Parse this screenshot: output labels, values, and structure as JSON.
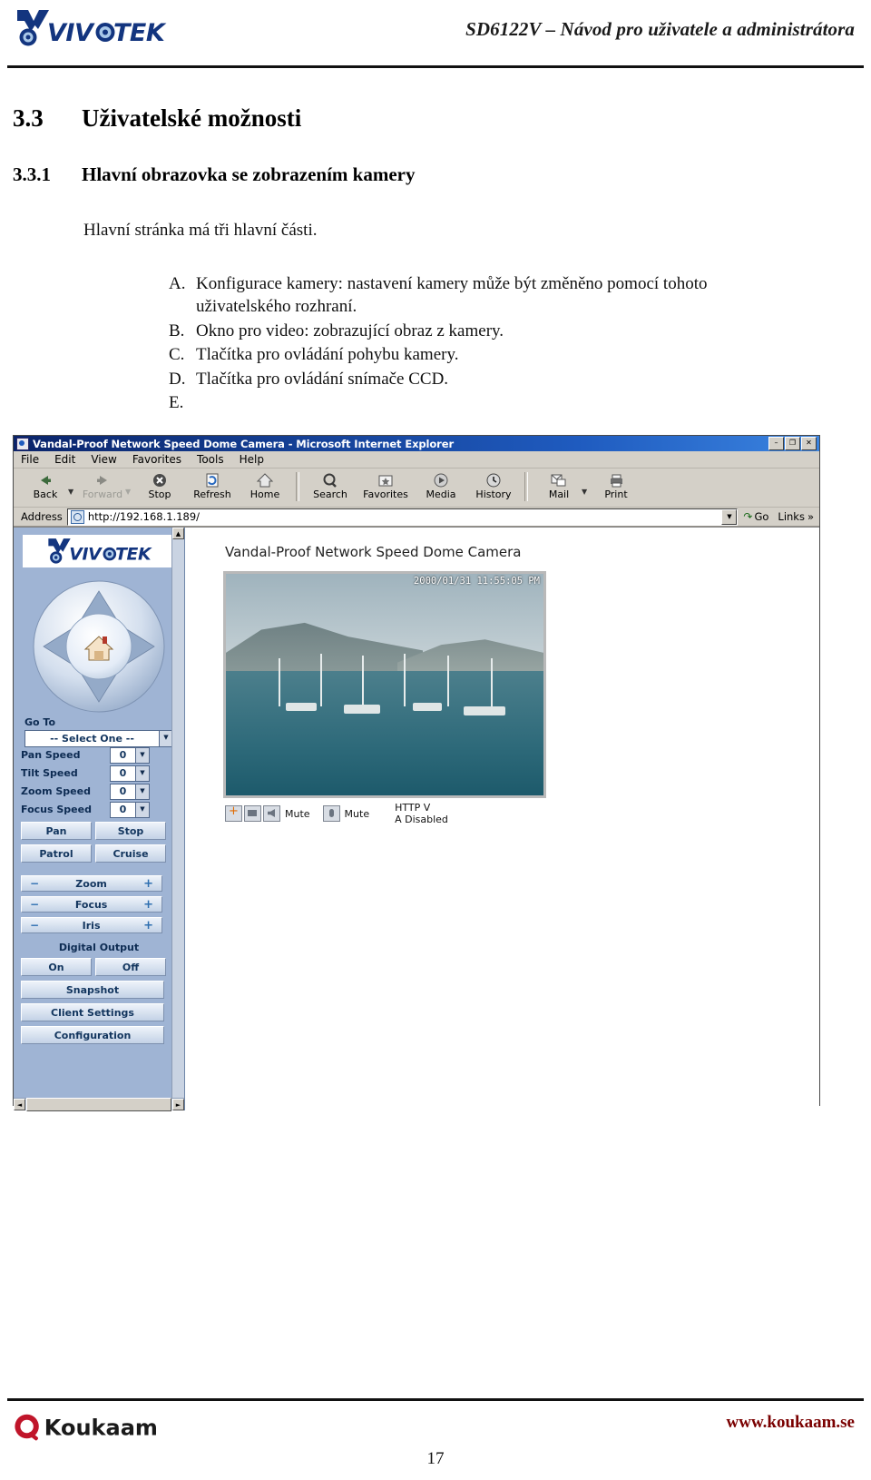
{
  "header": {
    "logo": "vivotek-logo",
    "title": "SD6122V – Návod pro uživatele a administrátora"
  },
  "document": {
    "section_number": "3.3",
    "section_title": "Uživatelské možnosti",
    "subsection_number": "3.3.1",
    "subsection_title": "Hlavní obrazovka se zobrazením kamery",
    "intro": "Hlavní stránka má tři hlavní části.",
    "items": [
      {
        "key": "A.",
        "text": "Konfigurace kamery: nastavení kamery může být změněno pomocí tohoto uživatelského rozhraní."
      },
      {
        "key": "B.",
        "text": "Okno pro video:  zobrazující obraz z kamery."
      },
      {
        "key": "C.",
        "text": "Tlačítka pro ovládání pohybu kamery."
      },
      {
        "key": "D.",
        "text": "Tlačítka pro ovládání snímače CCD."
      },
      {
        "key": "E.",
        "text": ""
      }
    ]
  },
  "browser": {
    "title": "Vandal-Proof Network Speed Dome Camera - Microsoft Internet Explorer",
    "window_buttons": [
      "–",
      "❐",
      "✕"
    ],
    "menus": [
      "File",
      "Edit",
      "View",
      "Favorites",
      "Tools",
      "Help"
    ],
    "toolbar": [
      {
        "label": "Back",
        "icon": "back-arrow-icon",
        "disabled": false,
        "dropdown": true
      },
      {
        "label": "Forward",
        "icon": "forward-arrow-icon",
        "disabled": true,
        "dropdown": true
      },
      {
        "label": "Stop",
        "icon": "stop-icon",
        "disabled": false,
        "dropdown": false
      },
      {
        "label": "Refresh",
        "icon": "refresh-icon",
        "disabled": false,
        "dropdown": false
      },
      {
        "label": "Home",
        "icon": "home-icon",
        "disabled": false,
        "dropdown": false
      },
      {
        "label": "Search",
        "icon": "search-icon",
        "disabled": false,
        "dropdown": false
      },
      {
        "label": "Favorites",
        "icon": "favorites-star-icon",
        "disabled": false,
        "dropdown": false
      },
      {
        "label": "Media",
        "icon": "media-icon",
        "disabled": false,
        "dropdown": false
      },
      {
        "label": "History",
        "icon": "history-icon",
        "disabled": false,
        "dropdown": false
      },
      {
        "label": "Mail",
        "icon": "mail-icon",
        "disabled": false,
        "dropdown": true
      },
      {
        "label": "Print",
        "icon": "print-icon",
        "disabled": false,
        "dropdown": false
      }
    ],
    "address_label": "Address",
    "address_value": "http://192.168.1.189/",
    "go_label": "Go",
    "links_label": "Links"
  },
  "camera": {
    "logo": "vivotek-logo",
    "joystick": {
      "home": "home-icon",
      "directions": [
        "up",
        "right",
        "down",
        "left"
      ]
    },
    "goto_label": "Go To",
    "goto_value": "-- Select One --",
    "speeds": [
      {
        "label": "Pan Speed",
        "value": "0"
      },
      {
        "label": "Tilt Speed",
        "value": "0"
      },
      {
        "label": "Zoom Speed",
        "value": "0"
      },
      {
        "label": "Focus Speed",
        "value": "0"
      }
    ],
    "move_buttons": [
      "Pan",
      "Stop",
      "Patrol",
      "Cruise"
    ],
    "lens_controls": [
      {
        "label": "Zoom",
        "minus": "−",
        "plus": "+"
      },
      {
        "label": "Focus",
        "minus": "−",
        "plus": "+"
      },
      {
        "label": "Iris",
        "minus": "−",
        "plus": "+"
      }
    ],
    "digital_output_label": "Digital Output",
    "digital_output_buttons": [
      "On",
      "Off"
    ],
    "action_buttons": [
      "Snapshot",
      "Client Settings",
      "Configuration"
    ],
    "page_heading": "Vandal-Proof Network Speed Dome Camera",
    "video_timestamp": "2000/01/31 11:55:05 PM",
    "video_controls": {
      "mute_video_label": "Mute",
      "mute_audio_label": "Mute",
      "status_line1": "HTTP  V",
      "status_line2": "A Disabled"
    }
  },
  "footer": {
    "logo": "koukaam-logo",
    "brand": "Koukaam",
    "url": "www.koukaam.se",
    "page_number": "17"
  },
  "colors": {
    "accent_blue": "#0a246a",
    "camera_panel": "#9fb4d4",
    "footer_red": "#7a0000",
    "logo_blue": "#13357f"
  }
}
